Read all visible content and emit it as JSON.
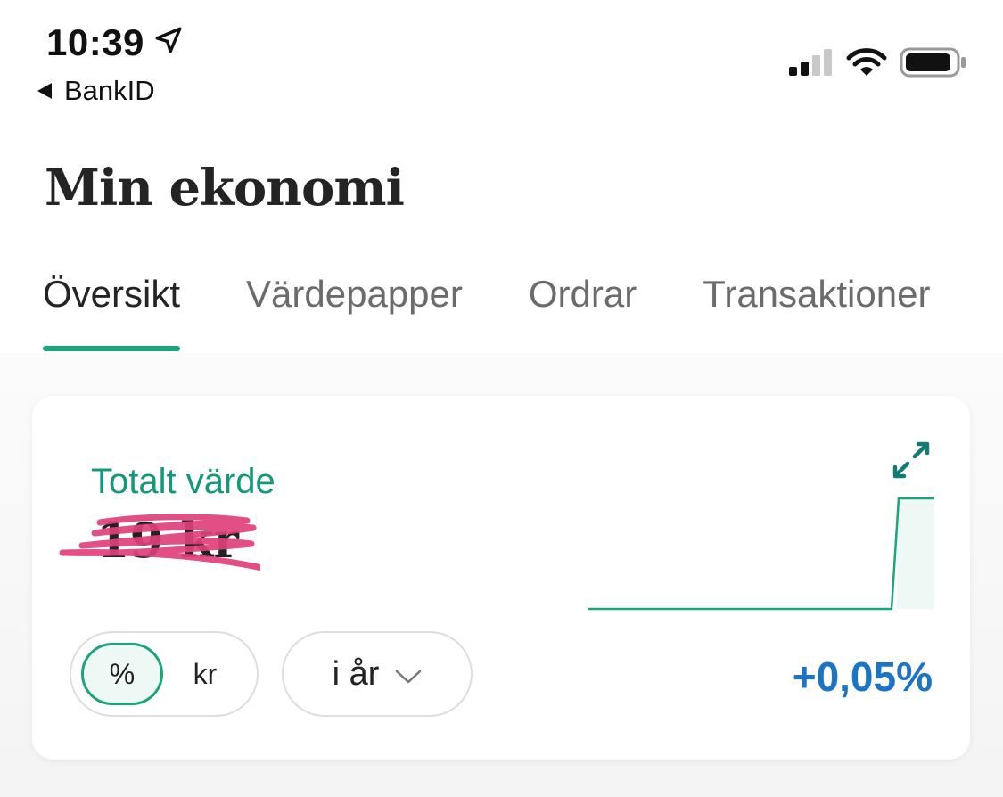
{
  "status_bar": {
    "time": "10:39",
    "back_label": "BankID"
  },
  "header": {
    "title": "Min ekonomi"
  },
  "tabs": [
    {
      "label": "Översikt",
      "active": true
    },
    {
      "label": "Värdepapper",
      "active": false
    },
    {
      "label": "Ordrar",
      "active": false
    },
    {
      "label": "Transaktioner",
      "active": false
    }
  ],
  "card": {
    "label": "Totalt värde",
    "value": "19 kr",
    "unit_toggle": {
      "percent_label": "%",
      "kr_label": "kr",
      "selected": "%"
    },
    "period": {
      "label": "i år"
    },
    "change": "+0,05%"
  },
  "colors": {
    "accent": "#1aa57d",
    "label_green": "#13997a",
    "change_blue": "#1b74c6",
    "scribble": "#e0407a"
  },
  "icons": [
    "location-arrow-icon",
    "back-triangle-icon",
    "signal-icon",
    "wifi-icon",
    "battery-icon",
    "expand-icon",
    "chevron-down-icon"
  ]
}
